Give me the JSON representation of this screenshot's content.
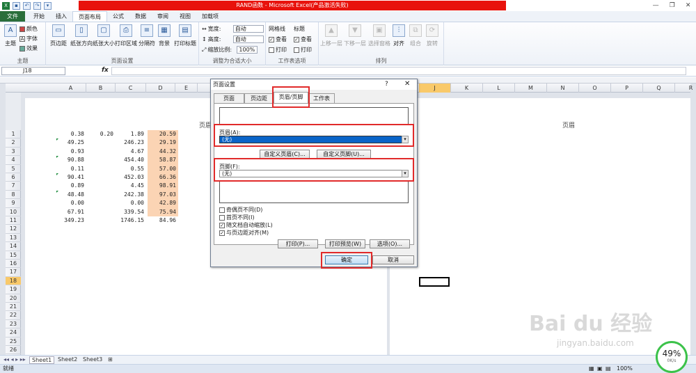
{
  "window": {
    "title": "RAND函数 - Microsoft Excel(产品激活失败)"
  },
  "tabs": [
    "文件",
    "开始",
    "插入",
    "页面布局",
    "公式",
    "数据",
    "审阅",
    "视图",
    "加载项"
  ],
  "ribbon": {
    "theme": {
      "label": "主题",
      "colors": "颜色",
      "fonts": "字体",
      "effects": "效果",
      "group": "主题"
    },
    "setup": {
      "margins": "页边距",
      "orientation": "纸张方向",
      "size": "纸张大小",
      "print_area": "打印区域",
      "breaks": "分隔符",
      "background": "背景",
      "print_titles": "打印标题",
      "group": "页面设置"
    },
    "scale": {
      "width_label": "宽度:",
      "width_value": "自动",
      "height_label": "高度:",
      "height_value": "自动",
      "scale_label": "缩放比例:",
      "scale_value": "100%",
      "group": "调整为合适大小"
    },
    "sheet_options": {
      "gridlines": "网格线",
      "headings": "标题",
      "view": "查看",
      "print": "打印",
      "group": "工作表选项"
    },
    "arrange": {
      "forward": "上移一层",
      "backward": "下移一层",
      "pane": "选择窗格",
      "align": "对齐",
      "group_btn": "组合",
      "rotate": "旋转",
      "group": "排列"
    }
  },
  "formula_bar": {
    "name_box": "J18",
    "fx": "fx"
  },
  "columns": [
    "A",
    "B",
    "C",
    "D",
    "E",
    "F",
    "G",
    "H",
    "I",
    "J",
    "K",
    "L",
    "M",
    "N",
    "O",
    "P",
    "Q",
    "R"
  ],
  "rows": [
    "1",
    "2",
    "3",
    "4",
    "5",
    "6",
    "7",
    "8",
    "9",
    "10",
    "11",
    "12",
    "13",
    "14",
    "15",
    "16",
    "17",
    "18",
    "19",
    "20",
    "21",
    "22",
    "23",
    "24",
    "25",
    "26"
  ],
  "header_text": "页眉",
  "cells": {
    "A": [
      "0.38",
      "49.25",
      "0.93",
      "90.88",
      "0.11",
      "90.41",
      "0.89",
      "48.48",
      "0.00",
      "67.91",
      "349.23"
    ],
    "B": [
      "0.20"
    ],
    "C": [
      "1.89",
      "246.23",
      "4.67",
      "454.40",
      "0.55",
      "452.03",
      "4.45",
      "242.38",
      "0.00",
      "339.54",
      "1746.15"
    ],
    "D": [
      "20.59",
      "29.19",
      "44.32",
      "58.87",
      "57.00",
      "66.36",
      "98.91",
      "97.03",
      "42.89",
      "75.94",
      "84.96"
    ]
  },
  "sheet_tabs": [
    "Sheet1",
    "Sheet2",
    "Sheet3"
  ],
  "status": {
    "ready": "就绪",
    "zoom": "100%"
  },
  "dialog": {
    "title": "页面设置",
    "tabs": [
      "页面",
      "页边距",
      "页眉/页脚",
      "工作表"
    ],
    "header_label": "页眉(A):",
    "header_value": "(无)",
    "custom_header": "自定义页眉(C)...",
    "custom_footer": "自定义页脚(U)...",
    "footer_label": "页脚(F):",
    "footer_value": "(无)",
    "checks": [
      {
        "label": "奇偶页不同(D)",
        "checked": false
      },
      {
        "label": "首页不同(I)",
        "checked": false
      },
      {
        "label": "随文档自动缩放(L)",
        "checked": true
      },
      {
        "label": "与页边距对齐(M)",
        "checked": true
      }
    ],
    "print": "打印(P)...",
    "preview": "打印预览(W)",
    "options": "选项(O)...",
    "ok": "确定",
    "cancel": "取消"
  },
  "watermark": {
    "brand": "Bai du 经验",
    "url": "jingyan.baidu.com"
  },
  "meter": {
    "percent": "49%",
    "speed": "0K/s"
  }
}
